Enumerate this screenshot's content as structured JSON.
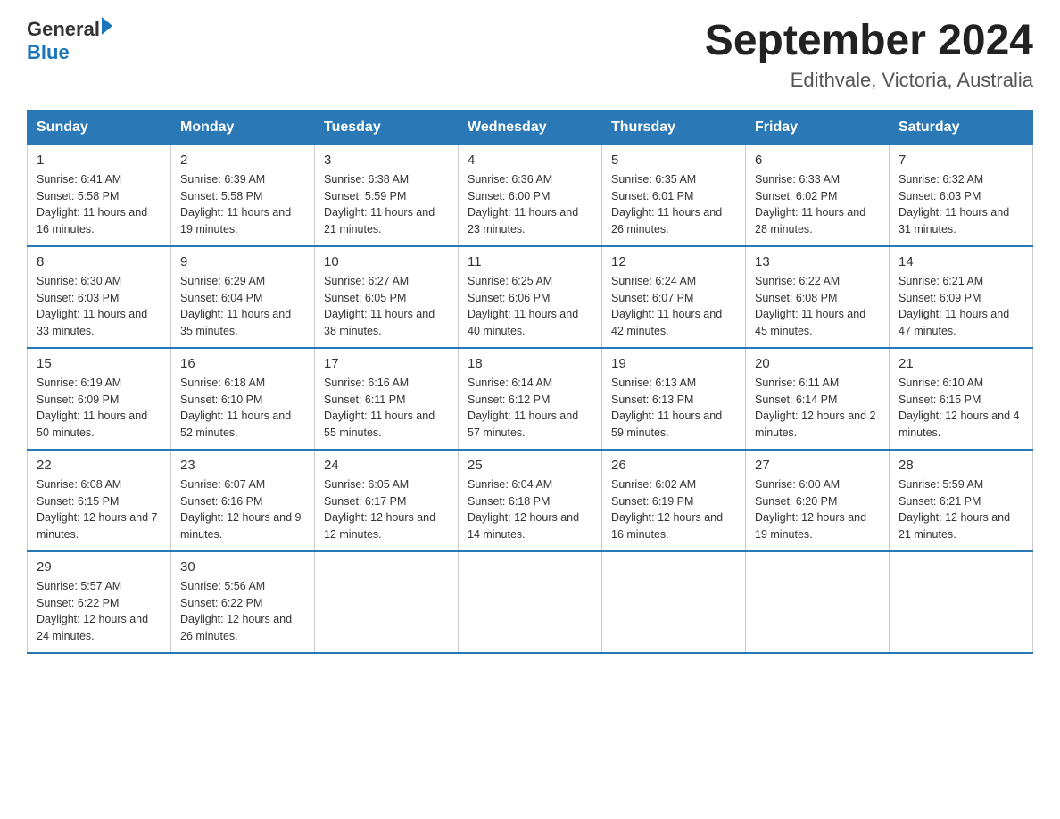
{
  "logo": {
    "general": "General",
    "blue": "Blue"
  },
  "title": "September 2024",
  "subtitle": "Edithvale, Victoria, Australia",
  "headers": [
    "Sunday",
    "Monday",
    "Tuesday",
    "Wednesday",
    "Thursday",
    "Friday",
    "Saturday"
  ],
  "weeks": [
    [
      {
        "day": "1",
        "sunrise": "6:41 AM",
        "sunset": "5:58 PM",
        "daylight": "11 hours and 16 minutes."
      },
      {
        "day": "2",
        "sunrise": "6:39 AM",
        "sunset": "5:58 PM",
        "daylight": "11 hours and 19 minutes."
      },
      {
        "day": "3",
        "sunrise": "6:38 AM",
        "sunset": "5:59 PM",
        "daylight": "11 hours and 21 minutes."
      },
      {
        "day": "4",
        "sunrise": "6:36 AM",
        "sunset": "6:00 PM",
        "daylight": "11 hours and 23 minutes."
      },
      {
        "day": "5",
        "sunrise": "6:35 AM",
        "sunset": "6:01 PM",
        "daylight": "11 hours and 26 minutes."
      },
      {
        "day": "6",
        "sunrise": "6:33 AM",
        "sunset": "6:02 PM",
        "daylight": "11 hours and 28 minutes."
      },
      {
        "day": "7",
        "sunrise": "6:32 AM",
        "sunset": "6:03 PM",
        "daylight": "11 hours and 31 minutes."
      }
    ],
    [
      {
        "day": "8",
        "sunrise": "6:30 AM",
        "sunset": "6:03 PM",
        "daylight": "11 hours and 33 minutes."
      },
      {
        "day": "9",
        "sunrise": "6:29 AM",
        "sunset": "6:04 PM",
        "daylight": "11 hours and 35 minutes."
      },
      {
        "day": "10",
        "sunrise": "6:27 AM",
        "sunset": "6:05 PM",
        "daylight": "11 hours and 38 minutes."
      },
      {
        "day": "11",
        "sunrise": "6:25 AM",
        "sunset": "6:06 PM",
        "daylight": "11 hours and 40 minutes."
      },
      {
        "day": "12",
        "sunrise": "6:24 AM",
        "sunset": "6:07 PM",
        "daylight": "11 hours and 42 minutes."
      },
      {
        "day": "13",
        "sunrise": "6:22 AM",
        "sunset": "6:08 PM",
        "daylight": "11 hours and 45 minutes."
      },
      {
        "day": "14",
        "sunrise": "6:21 AM",
        "sunset": "6:09 PM",
        "daylight": "11 hours and 47 minutes."
      }
    ],
    [
      {
        "day": "15",
        "sunrise": "6:19 AM",
        "sunset": "6:09 PM",
        "daylight": "11 hours and 50 minutes."
      },
      {
        "day": "16",
        "sunrise": "6:18 AM",
        "sunset": "6:10 PM",
        "daylight": "11 hours and 52 minutes."
      },
      {
        "day": "17",
        "sunrise": "6:16 AM",
        "sunset": "6:11 PM",
        "daylight": "11 hours and 55 minutes."
      },
      {
        "day": "18",
        "sunrise": "6:14 AM",
        "sunset": "6:12 PM",
        "daylight": "11 hours and 57 minutes."
      },
      {
        "day": "19",
        "sunrise": "6:13 AM",
        "sunset": "6:13 PM",
        "daylight": "11 hours and 59 minutes."
      },
      {
        "day": "20",
        "sunrise": "6:11 AM",
        "sunset": "6:14 PM",
        "daylight": "12 hours and 2 minutes."
      },
      {
        "day": "21",
        "sunrise": "6:10 AM",
        "sunset": "6:15 PM",
        "daylight": "12 hours and 4 minutes."
      }
    ],
    [
      {
        "day": "22",
        "sunrise": "6:08 AM",
        "sunset": "6:15 PM",
        "daylight": "12 hours and 7 minutes."
      },
      {
        "day": "23",
        "sunrise": "6:07 AM",
        "sunset": "6:16 PM",
        "daylight": "12 hours and 9 minutes."
      },
      {
        "day": "24",
        "sunrise": "6:05 AM",
        "sunset": "6:17 PM",
        "daylight": "12 hours and 12 minutes."
      },
      {
        "day": "25",
        "sunrise": "6:04 AM",
        "sunset": "6:18 PM",
        "daylight": "12 hours and 14 minutes."
      },
      {
        "day": "26",
        "sunrise": "6:02 AM",
        "sunset": "6:19 PM",
        "daylight": "12 hours and 16 minutes."
      },
      {
        "day": "27",
        "sunrise": "6:00 AM",
        "sunset": "6:20 PM",
        "daylight": "12 hours and 19 minutes."
      },
      {
        "day": "28",
        "sunrise": "5:59 AM",
        "sunset": "6:21 PM",
        "daylight": "12 hours and 21 minutes."
      }
    ],
    [
      {
        "day": "29",
        "sunrise": "5:57 AM",
        "sunset": "6:22 PM",
        "daylight": "12 hours and 24 minutes."
      },
      {
        "day": "30",
        "sunrise": "5:56 AM",
        "sunset": "6:22 PM",
        "daylight": "12 hours and 26 minutes."
      },
      null,
      null,
      null,
      null,
      null
    ]
  ]
}
